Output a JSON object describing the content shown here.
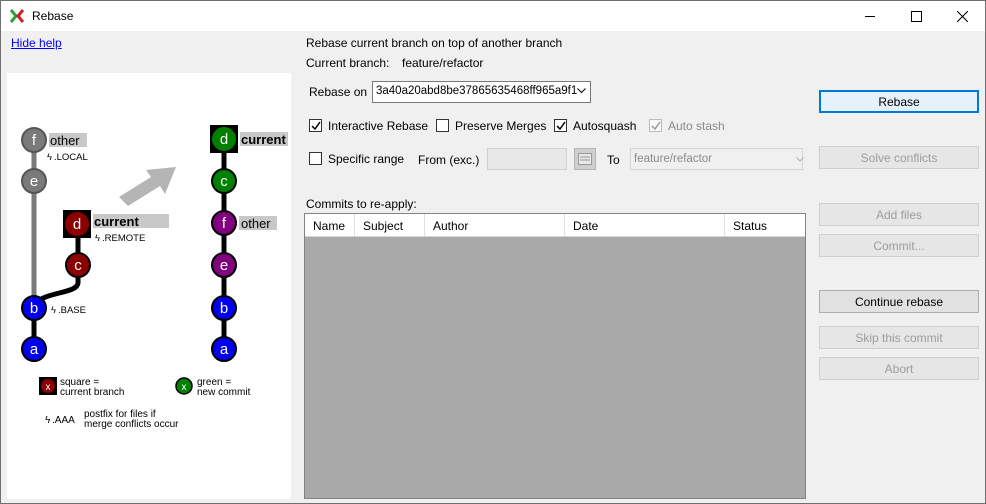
{
  "window": {
    "title": "Rebase"
  },
  "help": {
    "hide_link": "Hide help"
  },
  "diagram": {
    "left_nodes": [
      "f",
      "e",
      "d",
      "c",
      "b",
      "a"
    ],
    "right_nodes": [
      "d",
      "c",
      "f",
      "e",
      "b",
      "a"
    ],
    "labels": {
      "other": "other",
      "local": ".LOCAL",
      "current": "current",
      "remote": ".REMOTE",
      "base": ".BASE",
      "current_right": "current",
      "other_right": "other"
    },
    "legend": {
      "square_x": "x",
      "square_text_1": "square =",
      "square_text_2": "current branch",
      "green_x": "x",
      "green_text_1": "green =",
      "green_text_2": "new commit",
      "aaa": ".AAA",
      "aaa_text_1": "postfix for files if",
      "aaa_text_2": "merge conflicts occur"
    }
  },
  "main": {
    "heading": "Rebase current branch on top of another branch",
    "current_branch_label": "Current branch:",
    "current_branch_value": "feature/refactor",
    "rebase_on_label": "Rebase on",
    "rebase_on_value": "3a40a20abd8be37865635468ff965a9f1",
    "options": {
      "interactive_rebase": "Interactive Rebase",
      "preserve_merges": "Preserve Merges",
      "autosquash": "Autosquash",
      "auto_stash": "Auto stash",
      "specific_range": "Specific range",
      "from_label": "From (exc.)",
      "to_label": "To",
      "to_value": "feature/refactor"
    },
    "commits_label": "Commits to re-apply:",
    "columns": [
      "Name",
      "Subject",
      "Author",
      "Date",
      "Status"
    ]
  },
  "buttons": {
    "rebase": "Rebase",
    "solve_conflicts": "Solve conflicts",
    "add_files": "Add files",
    "commit": "Commit...",
    "continue_rebase": "Continue rebase",
    "skip_commit": "Skip this commit",
    "abort": "Abort"
  },
  "colors": {
    "gray_node": "#7a7a7a",
    "red_node": "#8b0000",
    "blue_node": "#0000ee",
    "green_node": "#008000",
    "purple_node": "#800080",
    "accent": "#0078d7",
    "grid_bg": "#a9a9a9"
  }
}
